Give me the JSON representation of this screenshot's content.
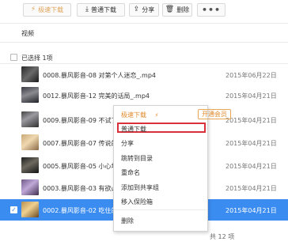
{
  "toolbar": {
    "turbo_download": "极速下载",
    "normal_download": "普通下载",
    "share": "分享",
    "delete": "删除",
    "more": "•••"
  },
  "section": {
    "title": "视频"
  },
  "selection": {
    "label": "已选择 1项"
  },
  "files": [
    {
      "name": "0008.暴风影音-08 对第个人迷恋_.mp4",
      "date": "2015年06月22日"
    },
    {
      "name": "0012.暴风影音-12 完美的话局_.mp4",
      "date": "2015年04月21日"
    },
    {
      "name": "0009.暴风影音-09 不试了我",
      "date": "2015年04月21日"
    },
    {
      "name": "0007.暴风影音-07 传说的底",
      "date": "2015年04月21日"
    },
    {
      "name": "0005.暴风影音-05 小心地下",
      "date": "2015年04月21日"
    },
    {
      "name": "0003.暴风影音-03 有欲必给",
      "date": "2015年04月21日"
    },
    {
      "name": "0002.暴风影音-02 吃住的题",
      "date": "2015年04月21日"
    }
  ],
  "context_menu": {
    "turbo_download": "极速下载",
    "vip": "开通会员",
    "normal_download": "普通下载",
    "share": "分享",
    "jump_to_dir": "跳转到目录",
    "rename": "重命名",
    "add_to_share_group": "添加到共享组",
    "move_to_safe": "移入保险箱",
    "delete": "删除"
  },
  "footer": {
    "total": "共 12 项"
  },
  "colors": {
    "selected_row": "#3b8cf0",
    "highlight": "#d8313b",
    "accent_orange": "#e08a2a"
  }
}
